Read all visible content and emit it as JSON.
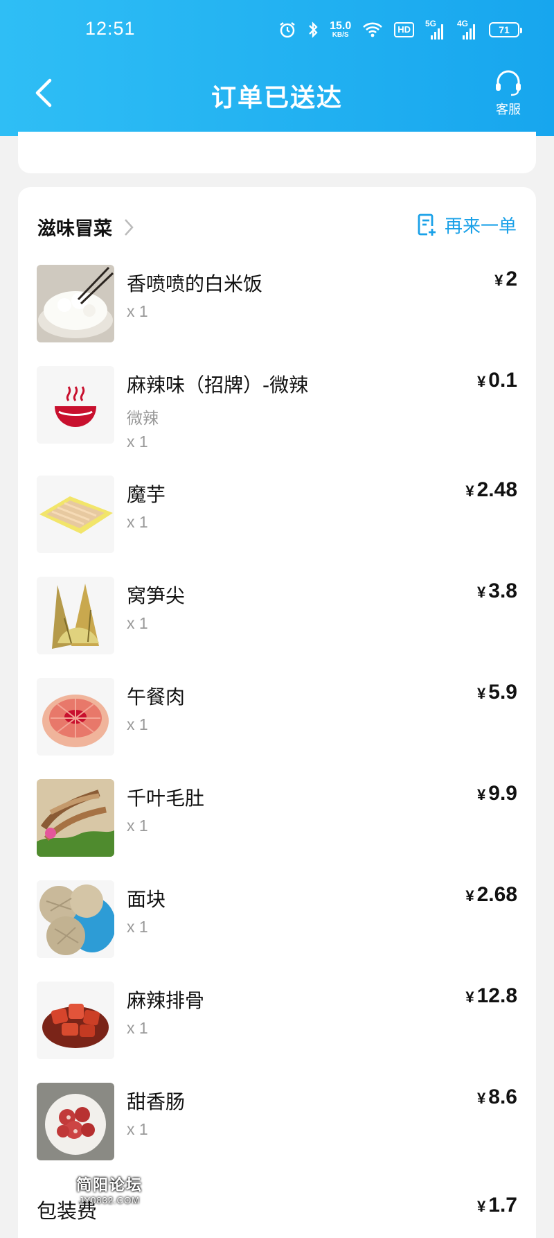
{
  "status_bar": {
    "time": "12:51",
    "speed_value": "15.0",
    "speed_unit": "KB/S",
    "hd_label": "HD",
    "net1": "5G",
    "net2": "4G",
    "battery": "71"
  },
  "header": {
    "title": "订单已送达",
    "service_label": "客服",
    "back_icon": "chevron-left-icon"
  },
  "shop": {
    "name": "滋味冒菜",
    "reorder_label": "再来一单"
  },
  "currency": "¥",
  "items": [
    {
      "name": "香喷喷的白米饭",
      "spec": "",
      "qty": "x 1",
      "price": "2"
    },
    {
      "name": "麻辣味（招牌）-微辣",
      "spec": "微辣",
      "qty": "x 1",
      "price": "0.1"
    },
    {
      "name": "魔芋",
      "spec": "",
      "qty": "x 1",
      "price": "2.48"
    },
    {
      "name": "窝笋尖",
      "spec": "",
      "qty": "x 1",
      "price": "3.8"
    },
    {
      "name": "午餐肉",
      "spec": "",
      "qty": "x 1",
      "price": "5.9"
    },
    {
      "name": "千叶毛肚",
      "spec": "",
      "qty": "x 1",
      "price": "9.9"
    },
    {
      "name": "面块",
      "spec": "",
      "qty": "x 1",
      "price": "2.68"
    },
    {
      "name": "麻辣排骨",
      "spec": "",
      "qty": "x 1",
      "price": "12.8"
    },
    {
      "name": "甜香肠",
      "spec": "",
      "qty": "x 1",
      "price": "8.6"
    }
  ],
  "packaging": {
    "label": "包装费",
    "price": "1.7"
  },
  "watermark": {
    "line1": "简阳论坛",
    "line2": "JY0832.COM"
  },
  "colors": {
    "header_start": "#2fbef5",
    "header_end": "#17a6ee",
    "accent": "#1aa1e8"
  }
}
